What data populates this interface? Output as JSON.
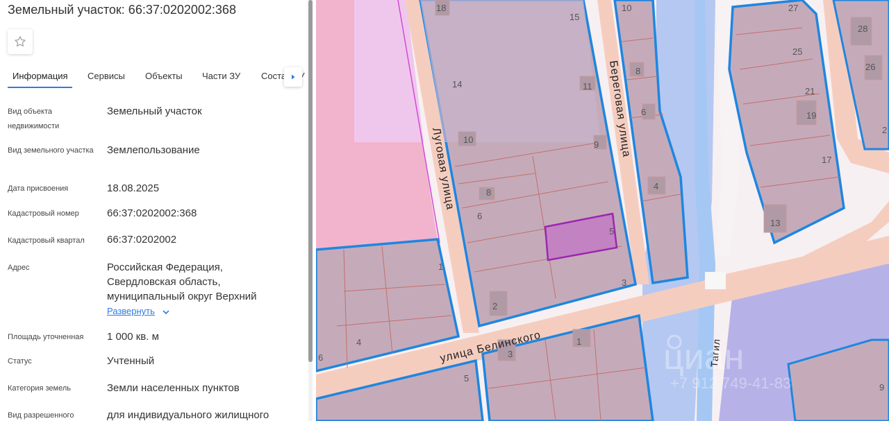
{
  "panel": {
    "title": "Земельный участок: 66:37:0202002:368",
    "favorite_icon": "star-icon",
    "tabs": [
      {
        "label": "Информация",
        "active": true
      },
      {
        "label": "Сервисы"
      },
      {
        "label": "Объекты"
      },
      {
        "label": "Части ЗУ"
      },
      {
        "label": "Состав ЗУ"
      }
    ],
    "tabs_next_icon": "caret-right-icon",
    "properties": [
      {
        "label": "Вид объекта недвижимости",
        "value": "Земельный участок"
      },
      {
        "label": "Вид земельного участка",
        "value": "Землепользование"
      },
      {
        "label": "Дата присвоения",
        "value": "18.08.2025"
      },
      {
        "label": "Кадастровый номер",
        "value": "66:37:0202002:368"
      },
      {
        "label": "Кадастровый квартал",
        "value": "66:37:0202002"
      },
      {
        "label": "Адрес",
        "value": "Российская Федерация, Свердловская область, муниципальный округ Верхний"
      },
      {
        "label": "Площадь уточненная",
        "value": "1 000 кв. м"
      },
      {
        "label": "Статус",
        "value": "Учтенный"
      },
      {
        "label": "Категория земель",
        "value": "Земли населенных пунктов"
      },
      {
        "label": "Вид разрешенного",
        "value": "для индивидуального жилищного"
      }
    ],
    "expand_label": "Развернуть",
    "expand_icon": "chevron-down-icon"
  },
  "map": {
    "streets": [
      "Луговая улица",
      "Береговая улица",
      "улица Белинского"
    ],
    "river": "Тагил",
    "parcel_numbers": [
      "18",
      "15",
      "14",
      "11",
      "10",
      "9",
      "8",
      "6",
      "5",
      "3",
      "2",
      "1",
      "1",
      "3",
      "4",
      "6",
      "5",
      "10",
      "8",
      "6",
      "4",
      "27",
      "28",
      "25",
      "26",
      "21",
      "19",
      "17",
      "13",
      "9",
      "2"
    ],
    "watermark": "циан",
    "watermark_phone": "+7 912 749-41-83",
    "colors": {
      "parcel_fill": "#c4a9b8",
      "parcel_border": "#1f86e0",
      "selected_parcel": "#9b27af",
      "road": "#f6c7b5",
      "water": "#9fbfef",
      "zone_pink": "#f2b3cd"
    }
  }
}
